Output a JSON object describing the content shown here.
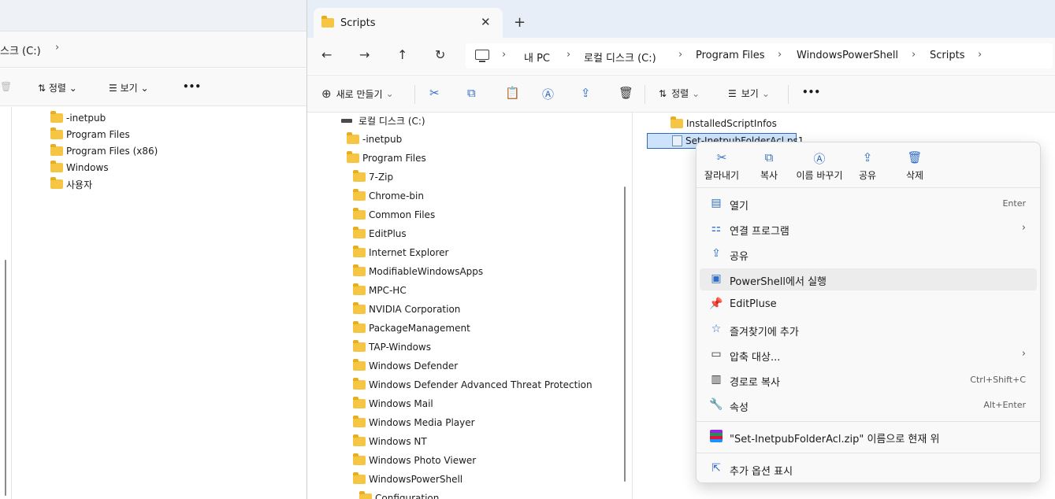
{
  "back_window": {
    "address_text": "스크 (C:)",
    "address_chevron": "›",
    "sort_label": "정렬",
    "view_label": "보기",
    "more_label": "•••",
    "tree": [
      "-inetpub",
      "Program Files",
      "Program Files (x86)",
      "Windows",
      "사용자"
    ]
  },
  "main_window": {
    "tab_title": "Scripts",
    "tab_close": "✕",
    "new_tab": "+",
    "nav": {
      "back": "←",
      "forward": "→",
      "up": "↑",
      "refresh": "↻"
    },
    "breadcrumbs": [
      "내 PC",
      "로컬 디스크 (C:)",
      "Program Files",
      "WindowsPowerShell",
      "Scripts"
    ],
    "crumb_sep": "›",
    "commands": {
      "new_label": "새로 만들기",
      "sort_label": "정렬",
      "view_label": "보기",
      "more_label": "•••"
    },
    "nav_tree": {
      "drive": "로컬 디스크 (C:)",
      "top": [
        "-inetpub",
        "Program Files"
      ],
      "program_files": [
        "7-Zip",
        "Chrome-bin",
        "Common Files",
        "EditPlus",
        "Internet Explorer",
        "ModifiableWindowsApps",
        "MPC-HC",
        "NVIDIA Corporation",
        "PackageManagement",
        "TAP-Windows",
        "Windows Defender",
        "Windows Defender Advanced Threat Protection",
        "Windows Mail",
        "Windows Media Player",
        "Windows NT",
        "Windows Photo Viewer",
        "WindowsPowerShell"
      ],
      "sub": "Configuration"
    },
    "files": [
      {
        "name": "InstalledScriptInfos",
        "kind": "folder"
      },
      {
        "name": "Set-InetpubFolderAcl.ps1",
        "kind": "ps1"
      }
    ]
  },
  "context_menu": {
    "quick_actions": [
      {
        "label": "잘라내기",
        "icon": "cut-icon"
      },
      {
        "label": "복사",
        "icon": "copy-icon"
      },
      {
        "label": "이름 바꾸기",
        "icon": "rename-icon"
      },
      {
        "label": "공유",
        "icon": "share-icon"
      },
      {
        "label": "삭제",
        "icon": "delete-icon"
      }
    ],
    "items": [
      {
        "label": "열기",
        "shortcut": "Enter",
        "icon": "open-icon"
      },
      {
        "label": "연결 프로그램",
        "submenu": "›",
        "icon": "open-with-icon"
      },
      {
        "label": "공유",
        "icon": "share-icon"
      },
      {
        "label": "PowerShell에서 실행",
        "icon": "powershell-icon"
      },
      {
        "label": "EditPluse",
        "icon": "pin-icon"
      },
      {
        "label": "즐겨찾기에 추가",
        "icon": "star-icon"
      },
      {
        "label": "압축 대상...",
        "submenu": "›",
        "icon": "zip-folder-icon"
      },
      {
        "label": "경로로 복사",
        "shortcut": "Ctrl+Shift+C",
        "icon": "copy-path-icon"
      },
      {
        "label": "속성",
        "shortcut": "Alt+Enter",
        "icon": "wrench-icon"
      }
    ],
    "zip_item": "\"Set-InetpubFolderAcl.zip\" 이름으로 현재 위",
    "more_options": "추가 옵션 표시"
  },
  "colors": {
    "accent": "#2f6dc6",
    "selection": "#cde3fb",
    "folder": "#f6c544"
  }
}
